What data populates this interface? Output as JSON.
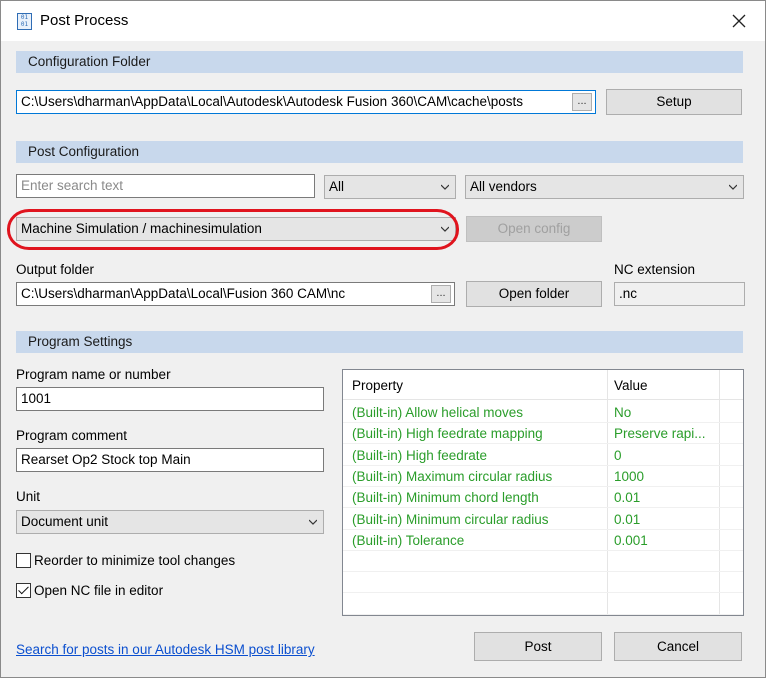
{
  "window": {
    "title": "Post Process"
  },
  "config_folder": {
    "header": "Configuration Folder",
    "path": "C:\\Users\\dharman\\AppData\\Local\\Autodesk\\Autodesk Fusion 360\\CAM\\cache\\posts",
    "browse_label": "...",
    "setup_label": "Setup"
  },
  "post_config": {
    "header": "Post Configuration",
    "search_placeholder": "Enter search text",
    "filter_value": "All",
    "vendor_value": "All vendors",
    "post_value": "Machine Simulation / machinesimulation",
    "open_config_label": "Open config",
    "output_folder_label": "Output folder",
    "output_folder_path": "C:\\Users\\dharman\\AppData\\Local\\Fusion 360 CAM\\nc",
    "output_browse_label": "...",
    "open_folder_label": "Open folder",
    "nc_extension_label": "NC extension",
    "nc_extension_value": ".nc",
    "highlight_color": "#e0141e"
  },
  "program_settings": {
    "header": "Program Settings",
    "program_name_label": "Program name or number",
    "program_name_value": "1001",
    "program_comment_label": "Program comment",
    "program_comment_value": "Rearset Op2 Stock top Main",
    "unit_label": "Unit",
    "unit_value": "Document unit",
    "reorder_label": "Reorder to minimize tool changes",
    "reorder_checked": false,
    "open_nc_label": "Open NC file in editor",
    "open_nc_checked": true
  },
  "properties": {
    "col_property": "Property",
    "col_value": "Value",
    "rows": [
      {
        "property": "(Built-in) Allow helical moves",
        "value": "No"
      },
      {
        "property": "(Built-in) High feedrate mapping",
        "value": "Preserve rapi..."
      },
      {
        "property": "(Built-in) High feedrate",
        "value": "0"
      },
      {
        "property": "(Built-in) Maximum circular radius",
        "value": "1000"
      },
      {
        "property": "(Built-in) Minimum chord length",
        "value": "0.01"
      },
      {
        "property": "(Built-in) Minimum circular radius",
        "value": "0.01"
      },
      {
        "property": "(Built-in) Tolerance",
        "value": "0.001"
      }
    ]
  },
  "footer": {
    "library_link": "Search for posts in our Autodesk HSM post library",
    "post_label": "Post",
    "cancel_label": "Cancel"
  }
}
